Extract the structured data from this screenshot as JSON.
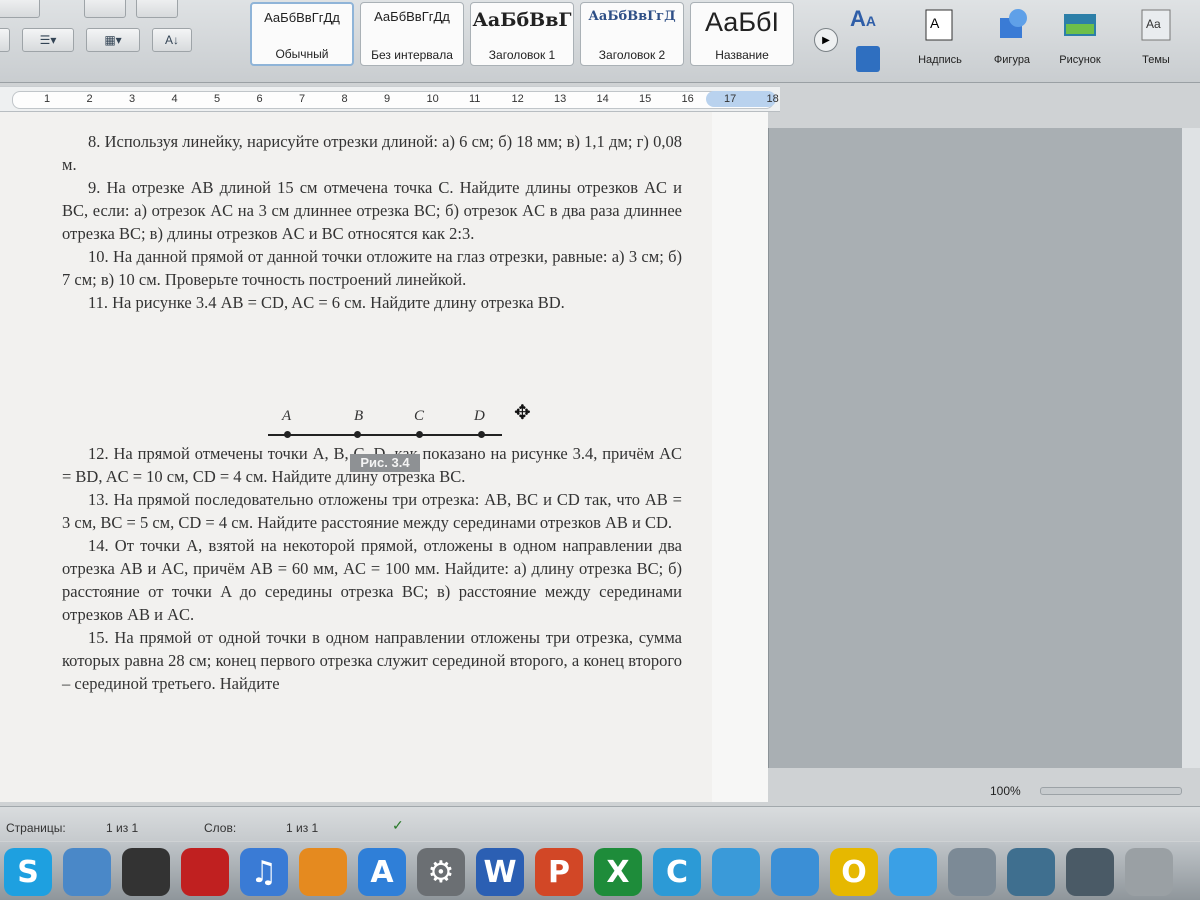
{
  "ribbon": {
    "styles": [
      {
        "sample": "АаБбВвГгДд",
        "name": "Обычный"
      },
      {
        "sample": "АаБбВвГгДд",
        "name": "Без интервала"
      },
      {
        "sample": "АаБбВвГ",
        "name": "Заголовок 1"
      },
      {
        "sample": "АаБбВвГгД",
        "name": "Заголовок 2"
      },
      {
        "sample": "АаБбI",
        "name": "Название"
      }
    ],
    "tools": [
      {
        "label": "Надпись",
        "icon": "textbox-icon"
      },
      {
        "label": "Фигура",
        "icon": "shape-icon"
      },
      {
        "label": "Рисунок",
        "icon": "picture-icon"
      },
      {
        "label": "Темы",
        "icon": "themes-icon"
      }
    ]
  },
  "ruler": {
    "numbers": [
      "1",
      "2",
      "3",
      "4",
      "5",
      "6",
      "7",
      "8",
      "9",
      "10",
      "11",
      "12",
      "13",
      "14",
      "15",
      "16",
      "17",
      "18"
    ]
  },
  "document": {
    "paragraphs": [
      "8. Используя линейку, нарисуйте отрезки длиной: а) 6 см; б) 18 мм; в) 1,1 дм; г) 0,08 м.",
      "9. На отрезке AB длиной 15 см отмечена точка C. Найдите длины отрезков AC и BC, если: а) отрезок AC на 3 см длиннее отрезка BC; б) отрезок AC в два раза длиннее отрезка BC; в) длины отрезков AC и BC относятся как 2:3.",
      "10. На данной прямой от данной точки отложите на глаз отрезки, равные: а) 3 см; б) 7 см; в) 10 см. Проверьте точность построений линейкой.",
      "11. На рисунке 3.4 AB = CD, AC = 6 см. Найдите длину отрезка BD."
    ],
    "paragraphs_after": [
      "12. На прямой отмечены точки A, B, C, D, как показано на рисунке 3.4, причём AC = BD, AC = 10 см, CD = 4 см. Найдите длину отрезка BC.",
      "13. На прямой последовательно отложены три отрезка: AB, BC и CD так, что AB = 3 см, BC = 5 см, CD = 4 см. Найдите расстояние между серединами отрезков AB и CD.",
      "14. От точки A, взятой на некоторой прямой, отложены в одном направлении два отрезка AB и AC, причём AB = 60 мм, AC = 100 мм. Найдите: а) длину отрезка BC; б) расстояние от точки A до середины отрезка BC; в) расстояние между серединами отрезков AB и AC.",
      "15. На прямой от одной точки в одном направлении отложены три отрезка, сумма которых равна 28 см; конец первого отрезка служит серединой второго, а конец второго – серединой третьего. Найдите"
    ],
    "figure": {
      "points": [
        "A",
        "B",
        "C",
        "D"
      ],
      "caption": "Рис. 3.4"
    }
  },
  "status": {
    "pages_label": "Страницы:",
    "pages_value": "1 из 1",
    "words_label": "Слов:",
    "words_value": "1 из 1",
    "zoom": "100%"
  },
  "dock": {
    "apps": [
      {
        "icon": "skype-icon",
        "glyph": "S",
        "color": "#1ea0e0"
      },
      {
        "icon": "finder-icon",
        "glyph": "",
        "color": "#4a88c8"
      },
      {
        "icon": "camera-icon",
        "glyph": "",
        "color": "#333333"
      },
      {
        "icon": "photo-booth-icon",
        "glyph": "",
        "color": "#c02020"
      },
      {
        "icon": "itunes-icon",
        "glyph": "♫",
        "color": "#3a7bd5"
      },
      {
        "icon": "ibooks-icon",
        "glyph": "",
        "color": "#e58a1f"
      },
      {
        "icon": "app-store-icon",
        "glyph": "A",
        "color": "#2f7fd8"
      },
      {
        "icon": "system-prefs-icon",
        "glyph": "⚙",
        "color": "#6b6f73"
      },
      {
        "icon": "word-icon",
        "glyph": "W",
        "color": "#2b5fb3"
      },
      {
        "icon": "powerpoint-icon",
        "glyph": "P",
        "color": "#d24726"
      },
      {
        "icon": "excel-icon",
        "glyph": "X",
        "color": "#1e8c3a"
      },
      {
        "icon": "communicator-icon",
        "glyph": "C",
        "color": "#2c9ad6"
      },
      {
        "icon": "messenger-icon",
        "glyph": "",
        "color": "#3a9ad9"
      },
      {
        "icon": "safari-alt-icon",
        "glyph": "",
        "color": "#3b8fd6"
      },
      {
        "icon": "outlook-icon",
        "glyph": "O",
        "color": "#e6b800"
      },
      {
        "icon": "safari-icon",
        "glyph": "",
        "color": "#3aa0e6"
      },
      {
        "icon": "preview-icon",
        "glyph": "",
        "color": "#7c8a96"
      },
      {
        "icon": "desktop-icon",
        "glyph": "",
        "color": "#3f6f8f"
      },
      {
        "icon": "downloads-icon",
        "glyph": "",
        "color": "#4a5a66"
      },
      {
        "icon": "trash-icon",
        "glyph": "",
        "color": "#9aa0a4"
      }
    ]
  }
}
